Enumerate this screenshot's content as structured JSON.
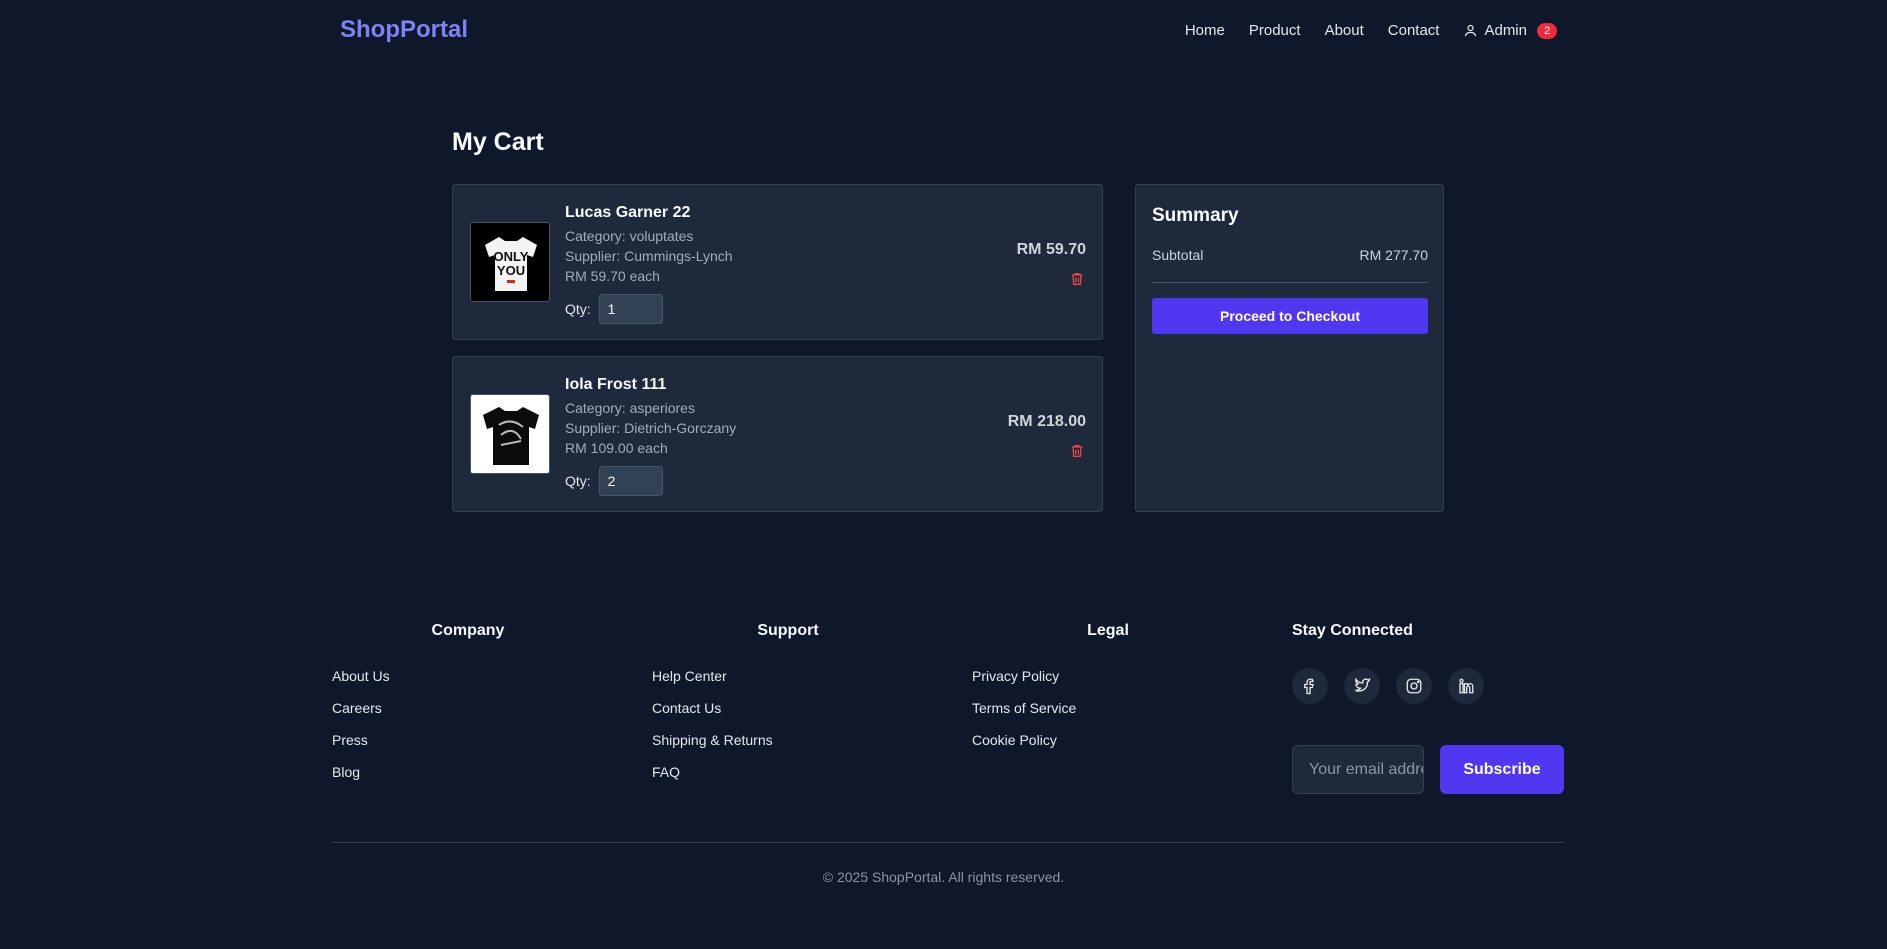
{
  "nav": {
    "logo": "ShopPortal",
    "links": [
      "Home",
      "Product",
      "About",
      "Contact"
    ],
    "user_label": "Admin",
    "cart_count": "2"
  },
  "cart": {
    "title": "My Cart",
    "items": [
      {
        "name": "Lucas Garner 22",
        "category": "Category: voluptates",
        "supplier": "Supplier: Cummings-Lynch",
        "unit_price": "RM 59.70 each",
        "qty_label": "Qty:",
        "qty": "1",
        "line_total": "RM 59.70",
        "image_text": [
          "ONLY",
          "YOU"
        ]
      },
      {
        "name": "Iola Frost 111",
        "category": "Category: asperiores",
        "supplier": "Supplier: Dietrich-Gorczany",
        "unit_price": "RM 109.00 each",
        "qty_label": "Qty:",
        "qty": "2",
        "line_total": "RM 218.00"
      }
    ]
  },
  "summary": {
    "title": "Summary",
    "subtotal_label": "Subtotal",
    "subtotal_value": "RM 277.70",
    "checkout_label": "Proceed to Checkout"
  },
  "footer": {
    "columns": [
      {
        "title": "Company",
        "links": [
          "About Us",
          "Careers",
          "Press",
          "Blog"
        ]
      },
      {
        "title": "Support",
        "links": [
          "Help Center",
          "Contact Us",
          "Shipping & Returns",
          "FAQ"
        ]
      },
      {
        "title": "Legal",
        "links": [
          "Privacy Policy",
          "Terms of Service",
          "Cookie Policy"
        ]
      }
    ],
    "stay_connected": "Stay Connected",
    "social_icons": [
      "facebook-icon",
      "twitter-icon",
      "instagram-icon",
      "linkedin-icon"
    ],
    "email_placeholder": "Your email address",
    "subscribe_label": "Subscribe",
    "copyright": "© 2025 ShopPortal. All rights reserved."
  },
  "colors": {
    "background": "#0f172a",
    "card": "#1e293b",
    "accent": "#4f38ef",
    "logo": "#7c83f5",
    "badge": "#ef2b3a"
  }
}
